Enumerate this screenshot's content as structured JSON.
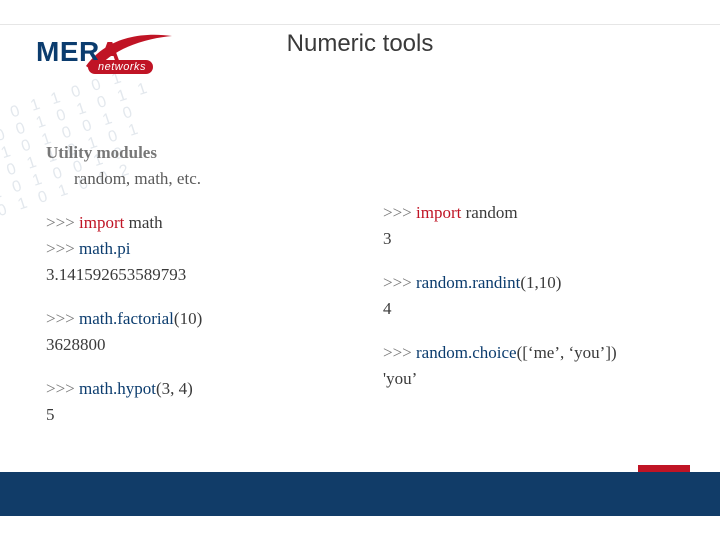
{
  "title": "Numeric tools",
  "logo": {
    "brand_main": "MER",
    "brand_accent": "A",
    "brand_sub": "networks"
  },
  "bg": {
    "r1": "0 1 0 1 1 0 0 1",
    "r2": "1 0 0 1 0 1 0 1 1",
    "r3": "0 1 0 1 0 0 1 0",
    "r4": "0 0 1 1 0 1 0 1",
    "r5": "1 0 1 0 0 1 0",
    "r6": "0 1 0 1 0 0 2"
  },
  "left": {
    "heading": "Utility modules",
    "subheading": "random, math, etc.",
    "l1_prompt": ">>> ",
    "l1_kw": "import",
    "l1_rest": " math",
    "l2_prompt": ">>> ",
    "l2_expr": "math.pi",
    "l2_out": "3.141592653589793",
    "l3_prompt": ">>> ",
    "l3_call": "math.factorial",
    "l3_open": "(",
    "l3_arg": "10",
    "l3_close": ")",
    "l3_out": "3628800",
    "l4_prompt": ">>> ",
    "l4_call": "math.hypot",
    "l4_open": "(",
    "l4_a1": "3",
    "l4_comma": ", ",
    "l4_a2": "4",
    "l4_close": ")",
    "l4_out": "5"
  },
  "right": {
    "r1_prompt": ">>> ",
    "r1_kw": "import",
    "r1_rest": " random",
    "r1_out": "3",
    "r2_prompt": ">>> ",
    "r2_call": "random.randint",
    "r2_open": "(",
    "r2_a1": "1",
    "r2_comma": ",",
    "r2_a2": "10",
    "r2_close": ")",
    "r2_out": "4",
    "r3_prompt": ">>> ",
    "r3_call": "random.choice",
    "r3_open": "(",
    "r3_lb": "[",
    "r3_s1": "‘me’",
    "r3_comma": ", ",
    "r3_s2": "‘you’",
    "r3_rb": "]",
    "r3_close": ")",
    "r3_out": "'you’"
  }
}
